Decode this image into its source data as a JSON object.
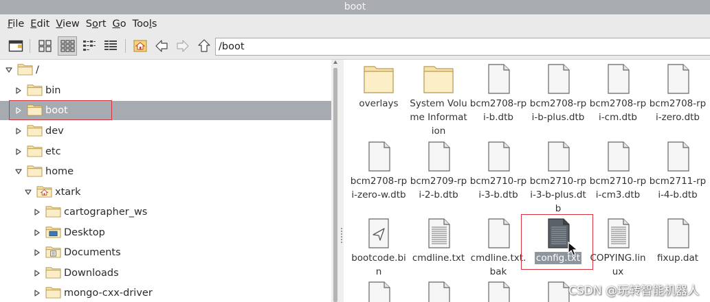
{
  "window": {
    "title": "boot"
  },
  "menu": [
    {
      "underline": "F",
      "rest": "ile"
    },
    {
      "underline": "E",
      "rest": "dit"
    },
    {
      "underline": "V",
      "rest": "iew"
    },
    {
      "pre": "S",
      "underline": "o",
      "rest": "rt"
    },
    {
      "underline": "G",
      "rest": "o"
    },
    {
      "pre": "Too",
      "underline": "l",
      "rest": "s"
    }
  ],
  "toolbar": {
    "icons": [
      "new-window-icon",
      "icon-view-icon",
      "thumbnail-view-icon",
      "compact-view-icon",
      "detailed-list-icon",
      "home-icon",
      "back-arrow-icon",
      "forward-arrow-icon",
      "up-arrow-icon"
    ],
    "path": "/boot"
  },
  "tree": [
    {
      "label": "/",
      "level": 0,
      "expanded": true,
      "icon": "folder"
    },
    {
      "label": "bin",
      "level": 1,
      "expanded": false,
      "icon": "folder"
    },
    {
      "label": "boot",
      "level": 1,
      "expanded": false,
      "icon": "folder",
      "selected": true
    },
    {
      "label": "dev",
      "level": 1,
      "expanded": false,
      "icon": "folder"
    },
    {
      "label": "etc",
      "level": 1,
      "expanded": false,
      "icon": "folder"
    },
    {
      "label": "home",
      "level": 1,
      "expanded": true,
      "icon": "folder"
    },
    {
      "label": "xtark",
      "level": 2,
      "expanded": true,
      "icon": "home-folder"
    },
    {
      "label": "cartographer_ws",
      "level": 3,
      "expanded": false,
      "icon": "folder"
    },
    {
      "label": "Desktop",
      "level": 3,
      "expanded": false,
      "icon": "desktop-folder"
    },
    {
      "label": "Documents",
      "level": 3,
      "expanded": false,
      "icon": "documents-folder"
    },
    {
      "label": "Downloads",
      "level": 3,
      "expanded": false,
      "icon": "folder"
    },
    {
      "label": "mongo-cxx-driver",
      "level": 3,
      "expanded": false,
      "icon": "folder"
    }
  ],
  "files": [
    {
      "name": "overlays",
      "type": "folder"
    },
    {
      "name": "System Volume Information",
      "type": "folder"
    },
    {
      "name": "bcm2708-rpi-b.dtb",
      "type": "file"
    },
    {
      "name": "bcm2708-rpi-b-plus.dtb",
      "type": "file"
    },
    {
      "name": "bcm2708-rpi-cm.dtb",
      "type": "file"
    },
    {
      "name": "bcm2708-rpi-zero.dtb",
      "type": "file"
    },
    {
      "name": "bcm2708-rpi-zero-w.dtb",
      "type": "file"
    },
    {
      "name": "bcm2709-rpi-2-b.dtb",
      "type": "file"
    },
    {
      "name": "bcm2710-rpi-3-b.dtb",
      "type": "file"
    },
    {
      "name": "bcm2710-rpi-3-b-plus.dtb",
      "type": "file"
    },
    {
      "name": "bcm2710-rpi-cm3.dtb",
      "type": "file"
    },
    {
      "name": "bcm2711-rpi-4-b.dtb",
      "type": "file"
    },
    {
      "name": "bootcode.bin",
      "type": "exec"
    },
    {
      "name": "cmdline.txt",
      "type": "text"
    },
    {
      "name": "cmdline.txt.bak",
      "type": "file"
    },
    {
      "name": "config.txt",
      "type": "text-dark",
      "selected": true
    },
    {
      "name": "COPYING.linux",
      "type": "text"
    },
    {
      "name": "fixup.dat",
      "type": "file"
    },
    {
      "name": "",
      "type": "file"
    },
    {
      "name": "",
      "type": "file"
    },
    {
      "name": "",
      "type": "file"
    },
    {
      "name": "",
      "type": "file"
    }
  ],
  "watermark": "CSDN @玩转智能机器人",
  "colors": {
    "selection": "#a6abb1",
    "highlight_box": "#d8323c",
    "titlebar": "#a9adb1"
  }
}
